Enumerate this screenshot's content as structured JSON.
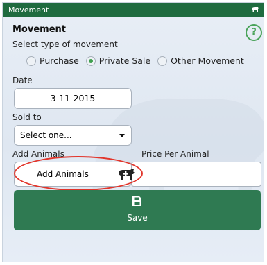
{
  "titlebar": {
    "title": "Movement"
  },
  "header": {
    "heading": "Movement",
    "help_symbol": "?"
  },
  "form": {
    "movement_prompt": "Select type of movement",
    "movement_types": [
      {
        "label": "Purchase",
        "selected": false
      },
      {
        "label": "Private Sale",
        "selected": true
      },
      {
        "label": "Other Movement",
        "selected": false
      }
    ],
    "date_label": "Date",
    "date_value": "3-11-2015",
    "sold_to_label": "Sold to",
    "sold_to_value": "Select one...",
    "add_animals_label": "Add Animals",
    "price_label": "Price Per Animal",
    "price_value": "",
    "add_animals_button": "Add Animals",
    "save_label": "Save"
  },
  "colors": {
    "titlebar": "#1f6b3f",
    "accent_green": "#4aa35a",
    "save_button": "#2f7a52",
    "highlight_red": "#e2352b"
  },
  "icons": {
    "help": "help-circle-icon",
    "radio_selected": "radio-selected-icon",
    "dropdown": "chevron-down-icon",
    "add_animal": "cow-plus-icon",
    "save": "floppy-disk-icon",
    "corner": "animal-icon"
  }
}
